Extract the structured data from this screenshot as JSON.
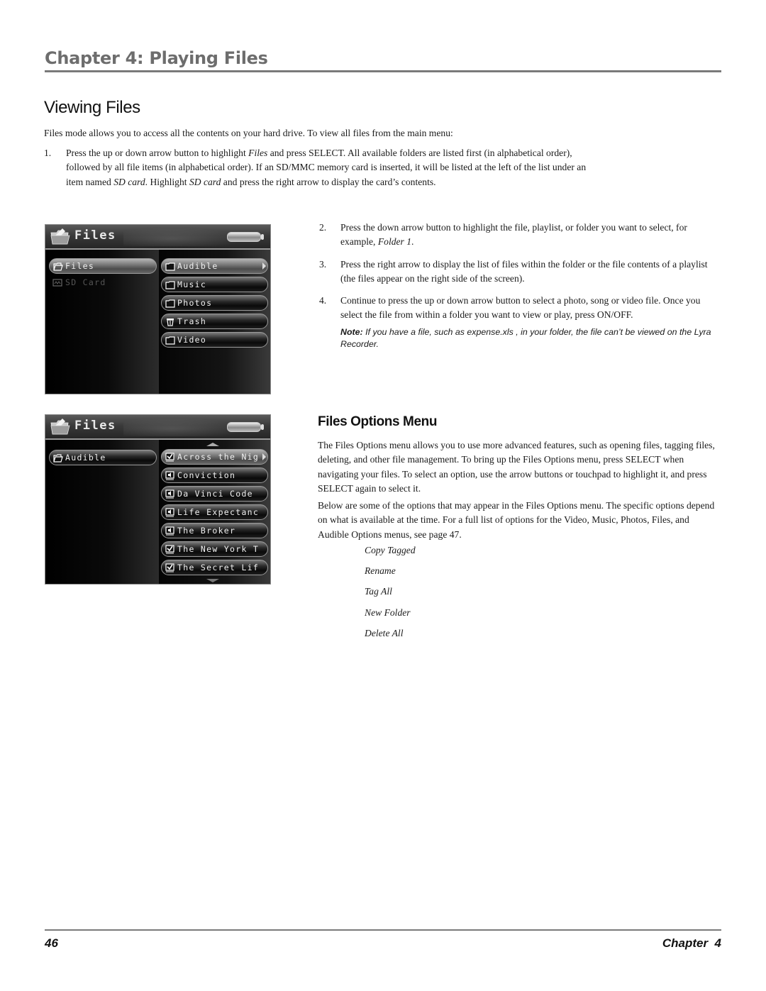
{
  "header": {
    "chapter_title": "Chapter 4: Playing Files"
  },
  "viewing_files": {
    "title": "Viewing Files",
    "intro": "Files mode allows you to access all the contents on your hard drive. To view all files from the main menu:",
    "step1": {
      "num": "1.",
      "parts": [
        "Press the up or down arrow button to highlight ",
        "Files",
        " and press SELECT. All available folders are listed first (in alphabetical order), followed by all file items (in alphabetical order). If an SD/MMC memory card is inserted, it will be listed at the left of the list under an item named ",
        "SD card",
        ". Highlight ",
        "SD card",
        " and press the right arrow to display the card’s contents."
      ]
    },
    "step2": {
      "num": "2.",
      "text_a": "Press the down arrow button to highlight the file, playlist, or folder you want to select, for example, ",
      "text_em": "Folder 1",
      "text_b": "."
    },
    "step3": {
      "num": "3.",
      "text": "Press the right arrow to display the list of files within the folder or the file contents of a playlist (the files appear on the right side of the screen)."
    },
    "step4": {
      "num": "4.",
      "text": "Continue to press the up or down arrow button to select a photo, song or video file. Once you select the file from within a folder you want to view or play, press ON/OFF."
    },
    "note": {
      "label": "Note:",
      "text": " If you have a file, such as expense.xls , in your folder, the file can’t be viewed on the Lyra Recorder."
    }
  },
  "screen_a": {
    "title": "Files",
    "left_items": [
      {
        "label": "Files",
        "icon": "open-folder-icon",
        "selected": true
      },
      {
        "label": "SD Card",
        "icon": "sd-card-icon",
        "selected": false,
        "dimmed": true
      }
    ],
    "right_items": [
      {
        "label": "Audible",
        "icon": "folder-icon",
        "selected": true
      },
      {
        "label": "Music",
        "icon": "folder-icon"
      },
      {
        "label": "Photos",
        "icon": "folder-icon"
      },
      {
        "label": "Trash",
        "icon": "trash-icon"
      },
      {
        "label": "Video",
        "icon": "folder-icon"
      }
    ]
  },
  "screen_b": {
    "title": "Files",
    "left_items": [
      {
        "label": "Audible",
        "icon": "open-folder-icon",
        "selected": false
      }
    ],
    "right_items": [
      {
        "label": "Across the Nig",
        "icon": "tagged-book-icon",
        "tagged": true,
        "selected": true
      },
      {
        "label": "Conviction",
        "icon": "audio-book-icon",
        "tagged": false
      },
      {
        "label": "Da Vinci Code",
        "icon": "audio-book-icon",
        "tagged": false
      },
      {
        "label": "Life Expectanc",
        "icon": "audio-book-icon",
        "tagged": false
      },
      {
        "label": "The Broker",
        "icon": "audio-book-icon",
        "tagged": false
      },
      {
        "label": "The New York T",
        "icon": "tagged-book-icon",
        "tagged": true
      },
      {
        "label": "The Secret Lif",
        "icon": "tagged-book-icon",
        "tagged": true
      }
    ]
  },
  "files_options": {
    "title": "Files Options Menu",
    "para1": "The Files Options menu allows you to use more advanced features, such as opening files, tagging files, deleting, and other file management. To bring up the Files Options menu, press SELECT when navigating your files. To select an option, use the arrow buttons or touchpad to highlight it, and press SELECT again to select it.",
    "para2": "Below are some of the options that may appear in the Files Options menu.  The specific options depend on what is available at the time. For a full list of options for the Video, Music, Photos, Files, and Audible Options menus, see page 47.",
    "options": [
      "Copy Tagged",
      "Rename",
      "Tag All",
      "New Folder",
      "Delete All"
    ]
  },
  "footer": {
    "page_number": "46",
    "chapter_label": "Chapter  4"
  }
}
